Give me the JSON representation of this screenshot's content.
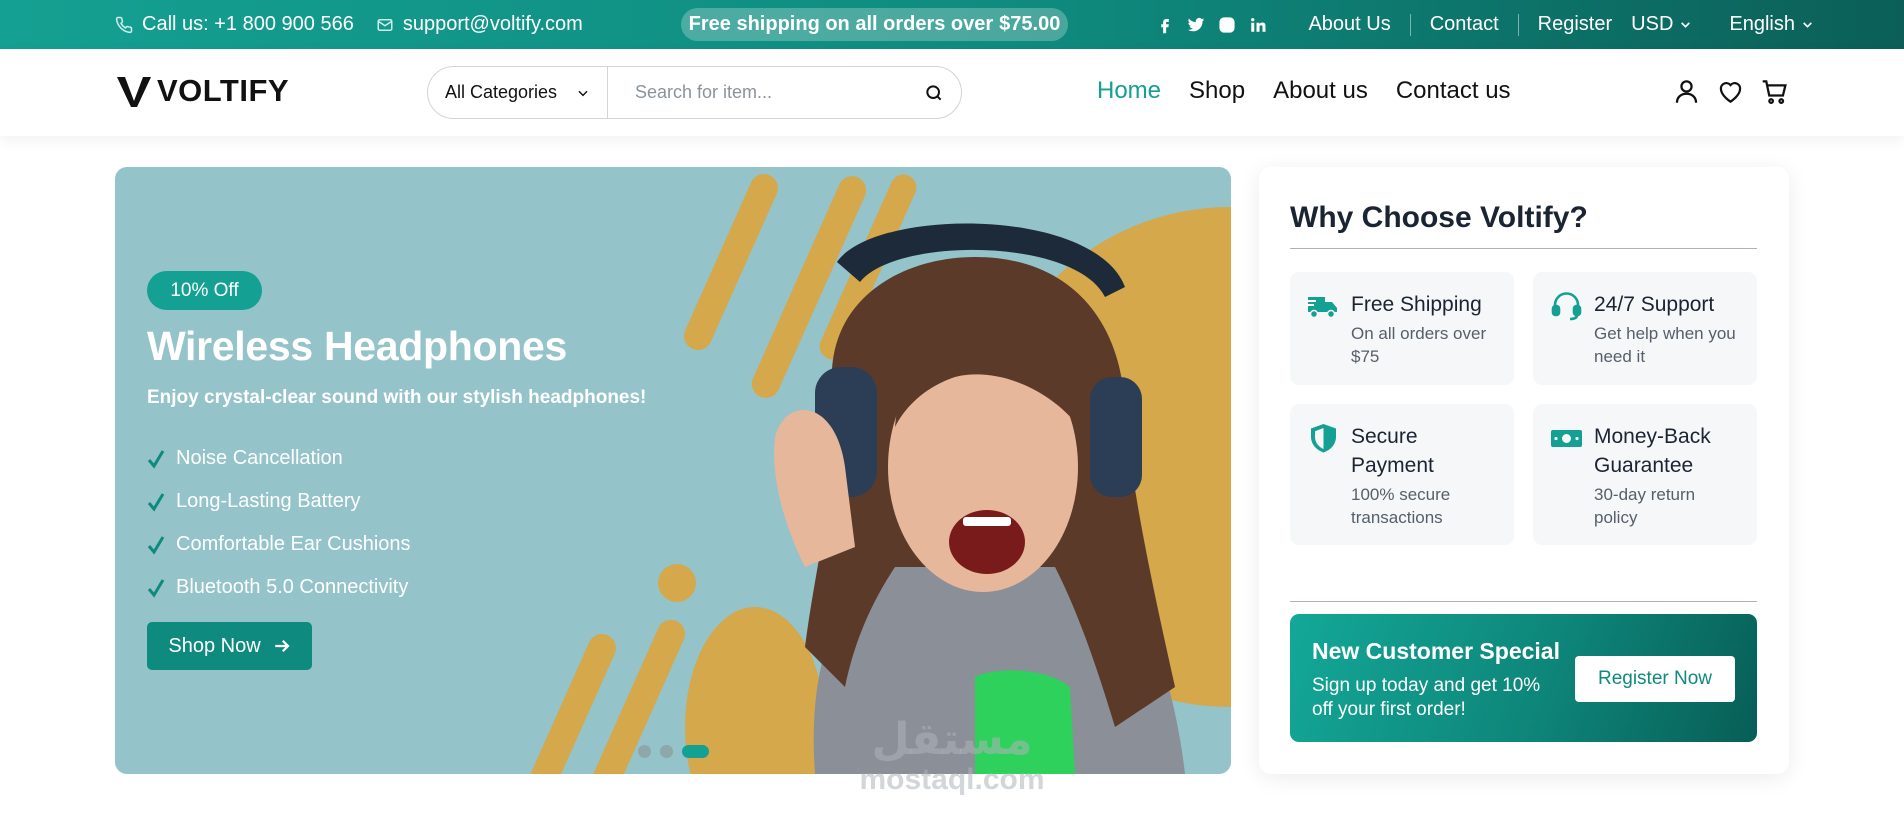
{
  "topbar": {
    "phone": "Call us: +1 800 900 566",
    "email": "support@voltify.com",
    "promo_text": "Free shipping on all orders over",
    "promo_amount": "$75.00",
    "social_icons": [
      "facebook-icon",
      "twitter-icon",
      "instagram-icon",
      "linkedin-icon"
    ],
    "links": [
      "About Us",
      "Contact",
      "Register"
    ],
    "currency": "USD",
    "language": "English"
  },
  "header": {
    "logo": "VOLTIFY",
    "category_select": "All Categories",
    "search_placeholder": "Search for item...",
    "nav": [
      "Home",
      "Shop",
      "About us",
      "Contact us"
    ],
    "active_nav": "Home",
    "icons": [
      "user-icon",
      "heart-icon",
      "cart-icon"
    ]
  },
  "hero": {
    "badge": "10% Off",
    "title": "Wireless Headphones",
    "subtitle": "Enjoy crystal-clear sound with our stylish headphones!",
    "features": [
      "Noise Cancellation",
      "Long-Lasting Battery",
      "Comfortable Ear Cushions",
      "Bluetooth 5.0 Connectivity"
    ],
    "cta": "Shop Now",
    "slides": 3,
    "active_slide": 3
  },
  "why": {
    "title": "Why Choose Voltify?",
    "cards": [
      {
        "title": "Free Shipping",
        "text": "On all orders over $75",
        "icon": "truck-icon"
      },
      {
        "title": "24/7 Support",
        "text": "Get help when you need it",
        "icon": "headset-icon"
      },
      {
        "title": "Secure Payment",
        "text": "100% secure transactions",
        "icon": "shield-icon"
      },
      {
        "title": "Money-Back Guarantee",
        "text": "30-day return policy",
        "icon": "money-icon"
      }
    ],
    "special": {
      "title": "New Customer Special",
      "text": "Sign up today and get 10% off your first order!",
      "button": "Register Now"
    }
  },
  "watermark": {
    "arabic": "مستقل",
    "latin": "mostaql.com"
  },
  "colors": {
    "accent": "#14a092",
    "accent_dark": "#0b5f58",
    "hero_bg": "#94c3ca",
    "hero_shape": "#d4a84b"
  }
}
